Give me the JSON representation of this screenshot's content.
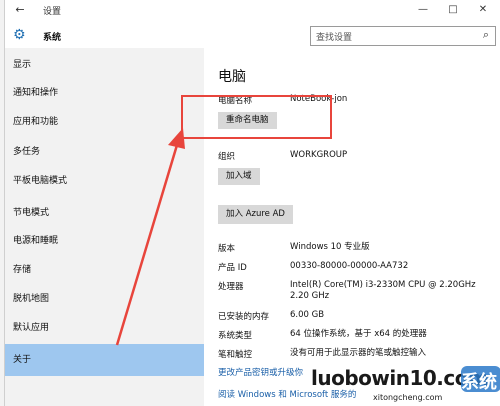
{
  "window": {
    "title": "设置",
    "controls": {
      "minimize": "—",
      "maximize": "□",
      "close": "✕"
    }
  },
  "header": {
    "icon": "gear-icon",
    "label": "系统",
    "search_placeholder": "查找设置"
  },
  "sidebar": {
    "items": [
      {
        "label": "显示",
        "active": false
      },
      {
        "label": "通知和操作",
        "active": false
      },
      {
        "label": "应用和功能",
        "active": false
      },
      {
        "label": "多任务",
        "active": false
      },
      {
        "label": "平板电脑模式",
        "active": false
      },
      {
        "label": "节电模式",
        "active": false
      },
      {
        "label": "电源和睡眠",
        "active": false
      },
      {
        "label": "存储",
        "active": false
      },
      {
        "label": "脱机地图",
        "active": false
      },
      {
        "label": "默认应用",
        "active": false
      },
      {
        "label": "关于",
        "active": true
      }
    ]
  },
  "main": {
    "heading": "电脑",
    "pc_name_label": "电脑名称",
    "pc_name_value": "NoteBook-jon",
    "rename_button": "重命名电脑",
    "org_label": "组织",
    "org_value": "WORKGROUP",
    "join_domain_button": "加入域",
    "join_azure_button": "加入 Azure AD",
    "specs": [
      {
        "label": "版本",
        "value": "Windows 10 专业版"
      },
      {
        "label": "产品 ID",
        "value": "00330-80000-00000-AA732"
      },
      {
        "label": "处理器",
        "value": "Intel(R) Core(TM) i3-2330M CPU @ 2.20GHz 2.20 GHz"
      },
      {
        "label": "已安装的内存",
        "value": "6.00 GB"
      },
      {
        "label": "系统类型",
        "value": "64 位操作系统，基于 x64 的处理器"
      },
      {
        "label": "笔和触控",
        "value": "没有可用于此显示器的笔或触控输入"
      }
    ],
    "link_1": "更改产品密钥或升级你",
    "link_2": "阅读 Windows 和 Microsoft 服务的"
  },
  "watermark": {
    "main": "luobowin10.com",
    "sub": "xitongcheng.com",
    "logo_chars": "系统"
  },
  "annotation_color": "#e8453c",
  "accent_color": "#9ec7ef"
}
